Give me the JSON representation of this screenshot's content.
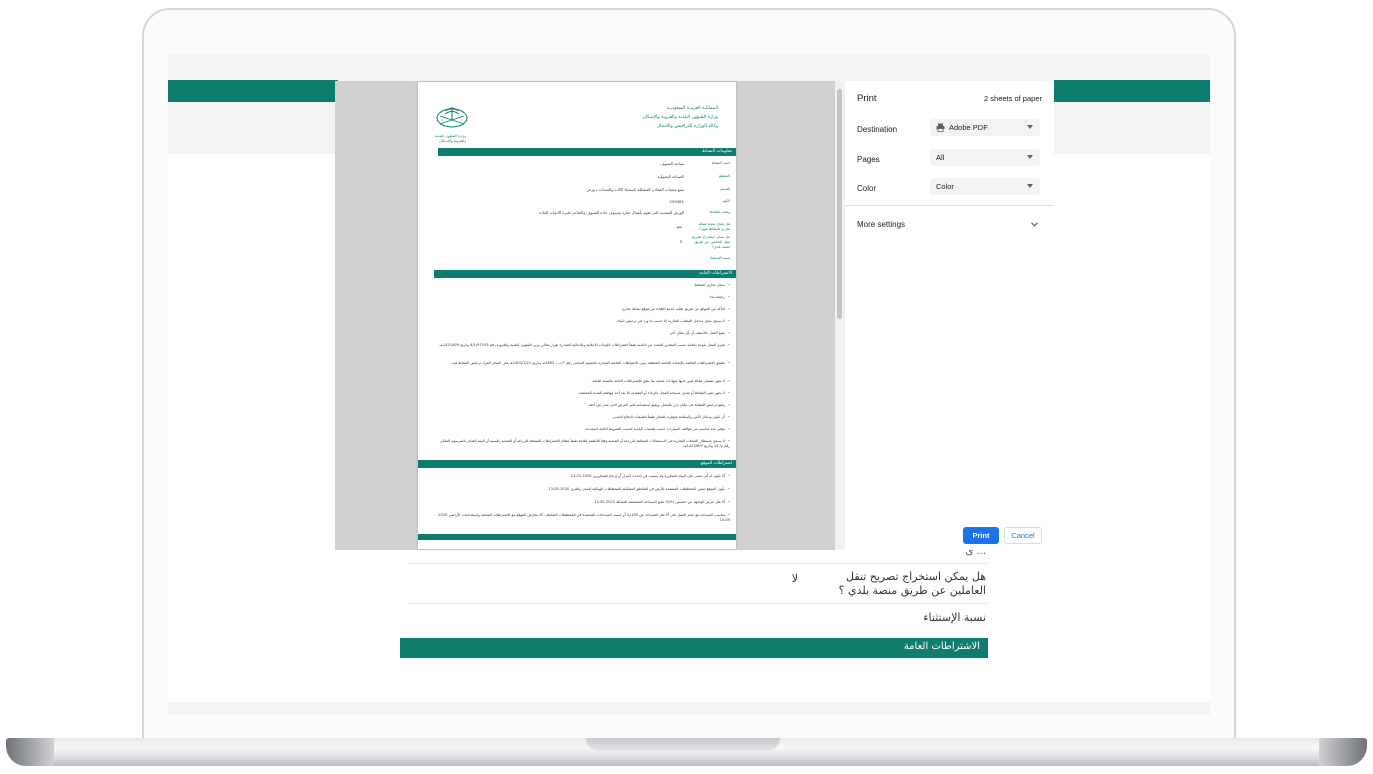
{
  "print_dialog": {
    "title": "Print",
    "sheet_count": "2 sheets of paper",
    "destination_label": "Destination",
    "destination_value": "Adobe PDF",
    "pages_label": "Pages",
    "pages_value": "All",
    "color_label": "Color",
    "color_value": "Color",
    "more_settings_label": "More settings",
    "print_button": "Print",
    "cancel_button": "Cancel"
  },
  "document": {
    "header_lines": [
      "المملكـة العربيـة السعوديـة",
      "وزارة الشؤون البلدية والقروية والإسكان",
      "وكالة الوزارة للتراخيص والامتثال"
    ],
    "logo_caption_1": "وزارة الشؤون البلدية",
    "logo_caption_2": "والقروية والإسكان",
    "section_activity": "معلومات النشاط",
    "fields": [
      {
        "label": "اسم النشاط",
        "value": "صناعة السيوف"
      },
      {
        "label": "المقطع",
        "value": "الصناعة التحويلية"
      },
      {
        "label": "القسم",
        "value": "صنع منتجات المعادن المشكلة باستثناء الآلات والمعدات / وزش"
      },
      {
        "label": "الكود",
        "value": "259381"
      },
      {
        "label": "وصف النشاط",
        "value": "الورش المعدنية التي تقوم بأعمال تجارة وسيوف حادة السيوف والخناجر ملبرة الادوات الحادة"
      },
      {
        "label": "هل تحتاج بحجة تشاله تجاري للنشاط هوتز؟",
        "value": "نعم"
      },
      {
        "label": "هل يمكن استخراج تصريح تنقل العاملين عن طريق منصة بلدي؟",
        "value": "لا"
      },
      {
        "label": "نسبة الإستثناء",
        "value": ""
      }
    ],
    "section_general": "الاشتراطات العامة",
    "general_items": [
      "سجل تجاري للنشاط.",
      "رخصة بناء.",
      "التأكد من الموقع عن طريق طلب خدمة الإفادة من موقع نشاط تجاري.",
      "لا يسمح بعمل مداخل المحلات التجارية إلا حسب ما ورد في ترخيص البناء.",
      "يمنع العمل بالأسقف أو بأي مكان آخر.",
      "يلتزم المحل بلوحة إعلانية حسب المقاس المحدد من البلدية طبقاً لاشتراطات اللوحات الإعلانية والدعائية الصادرة بقرار معالي وزير الشؤون البلدية والقروية رقم 4/1/97105 وتاريخ 1421/6/9هـ.",
      "تطبيق الاشتراطات الخاصة بالإضاءة الخاصة المتعلقة بدون الاحتياطات الخاصة الصادرة بالتعميم السامي رقم 7/ب / 1602هـ وتاريخ 1403/1/21هـ على المحل المراد ترخيص النشاط فيه.",
      "لا يجوز تشغيل عمالة ليس لديها شهادات صحية بما يتفق للاشتراطات العامة بالصحة العامة.",
      "لا يجوز تغيير النشاط أو تعديل مساحة المحل بالزيادة أو النقصان إلا بعد أخذ موافقة البلدية المختصة.",
      "وضع ترخيص النشاط في مكان بارز بالمحل، ويمنع استخدامه لغير الغرض الذي صدر من أجله.",
      "أن تكون وسائل الأمن والسلامة متوفرة بالمحل طبقاً لتعليمات الدفاع المدني.",
      "توفير عدد مناسب من مواقف السيارات حسب تعليمات البلدية لحسب الشروط العامة المحددة.",
      "لا يسمح باستغلال المحلات التجارية في الاستعمالات المتعلقة للزراعة أو الصحية وفقاً للأنظمة العامة طبقاً لنظام الاشتراطات المتعلقة للزراعة أو الصحية بالنسبة أو البيئة الصادر بالمرسوم الملكي رقم م/ 14 وتاريخ 1423/6/9هـ."
    ],
    "section_location": "اشتراطات الموقع",
    "location_items": [
      "ألا يكون له أثر سلبي على البيئة المجاورة ولا يتسبب في إحداث أضرار أو إزعاج للمجاورين 2020-05-13",
      "يكون الموقع ضمن المخططات المعتمدة للأرض في المناطق التشكيلة المخططات الهيكلية للمدن والقرى 2020-05-13",
      "ألا يقل عرض الواجهة عن خمسين (5/9) نصح المساحة المخصصة للنشاط 2020-05-13",
      "تتناسب المساحة مع حجم العمل على ألا تقل المساحة عن 100م2 أو حسب المساحات المعتمدة في المخططات الشاملة - ألا يتعارض الموقع مع الاشتراطات المحلية واستخدامات الأراضي 2020-05-13"
    ]
  },
  "background_page": {
    "cutoff_question": "هل يمكن استخراج تصريح تنقل العاملين عن طريق منصة بلدي ؟",
    "question_answer": "لا",
    "question_cut_text": "... ى",
    "exception_label": "نسبة الإستثناء",
    "section_title": "الاشتراطات العامة"
  },
  "icons": {
    "printer": "printer-icon",
    "chevron": "chevron-down-icon",
    "caret": "caret-down-icon"
  },
  "colors": {
    "brand_teal": "#0e7d6e",
    "print_blue": "#1a73e8"
  }
}
